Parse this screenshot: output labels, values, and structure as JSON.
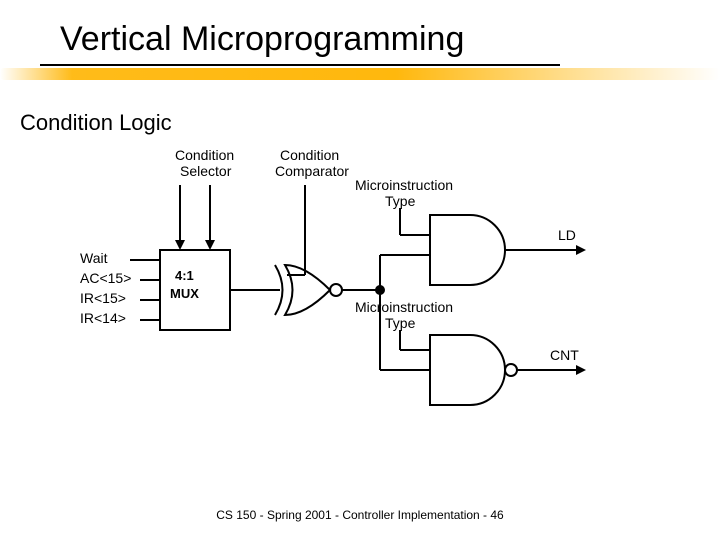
{
  "title": "Vertical Microprogramming",
  "subtitle": "Condition Logic",
  "footer": "CS 150 - Spring 2001 - Controller Implementation - 46",
  "labels": {
    "condition_selector": "Condition",
    "condition_selector2": "Selector",
    "condition_comparator": "Condition",
    "condition_comparator2": "Comparator",
    "microinstruction1a": "Microinstruction",
    "microinstruction1b": "Type",
    "microinstruction2a": "Microinstruction",
    "microinstruction2b": "Type",
    "ld": "LD",
    "cnt": "CNT",
    "mux1": "4:1",
    "mux2": "MUX",
    "inputs": {
      "wait": "Wait",
      "ac15": "AC<15>",
      "ir15": "IR<15>",
      "ir14": "IR<14>"
    }
  }
}
